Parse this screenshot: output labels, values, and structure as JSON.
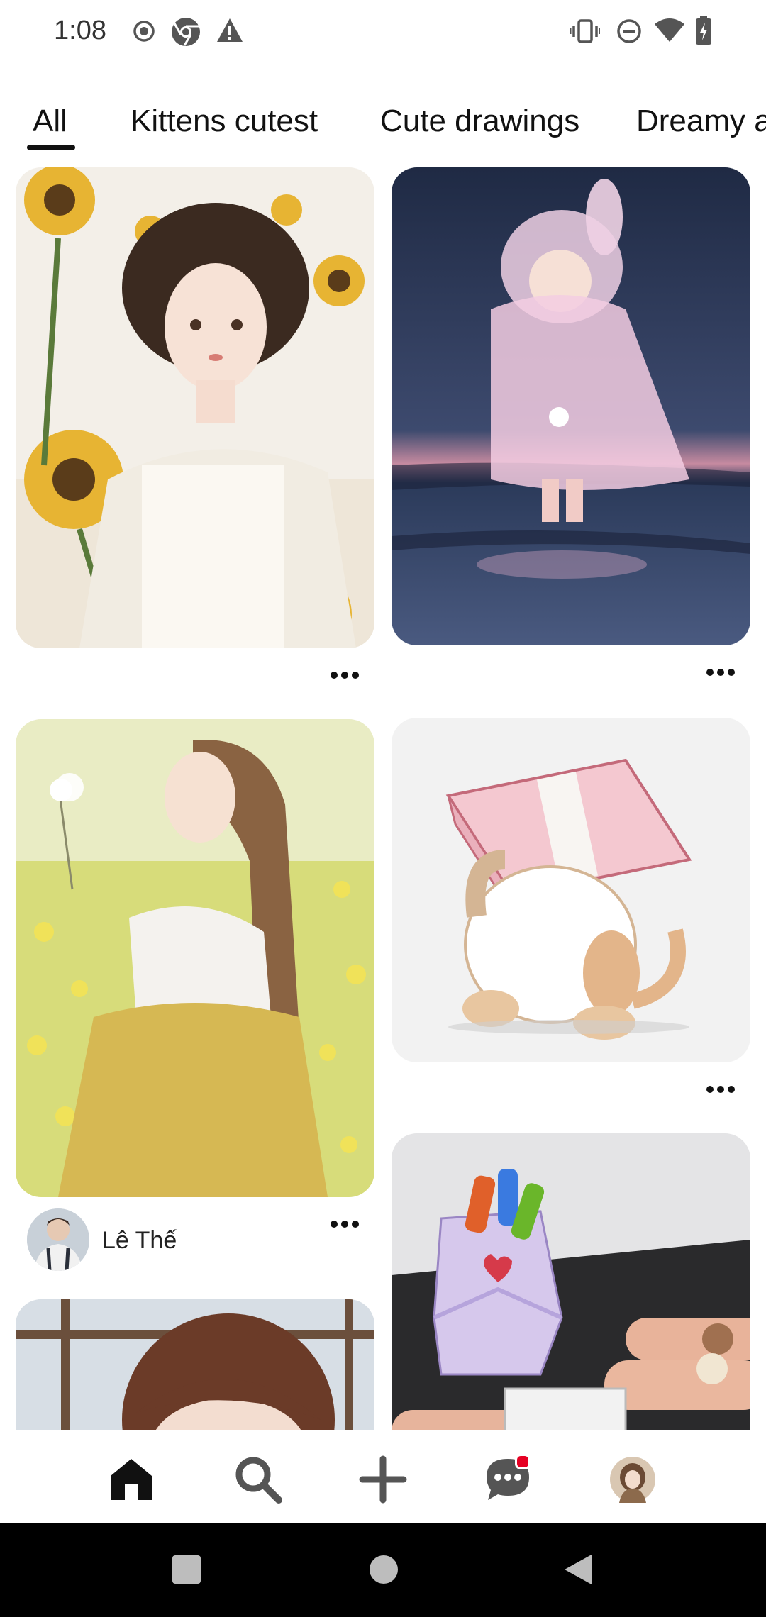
{
  "status_bar": {
    "time": "1:08",
    "left_icons": [
      "record-icon",
      "chrome-icon",
      "warning-icon"
    ],
    "right_icons": [
      "vibrate-icon",
      "do-not-disturb-icon",
      "wifi-icon",
      "battery-icon"
    ]
  },
  "tabs": [
    {
      "label": "All",
      "selected": true
    },
    {
      "label": "Kittens cutest",
      "selected": false
    },
    {
      "label": "Cute drawings",
      "selected": false
    },
    {
      "label": "Dreamy a",
      "selected": false
    }
  ],
  "pins": [
    {
      "image": "girl-with-sunflowers-illustration"
    },
    {
      "image": "girl-in-glowing-bunny-raincoat-illustration"
    },
    {
      "image": "girl-in-dandelion-field-illustration",
      "author": "Lê Thế"
    },
    {
      "image": "cat-carrying-money-stack-drawing"
    },
    {
      "image": "origami-pencil-holder-photo"
    },
    {
      "image": "girl-by-rainy-window-illustration"
    }
  ],
  "bottom_nav": {
    "items": [
      "home-icon",
      "search-icon",
      "create-icon",
      "messages-icon",
      "profile-avatar"
    ],
    "active": "home-icon",
    "accent_color": "#e60023"
  },
  "system_nav": [
    "recents-icon",
    "home-circle-icon",
    "back-icon"
  ]
}
